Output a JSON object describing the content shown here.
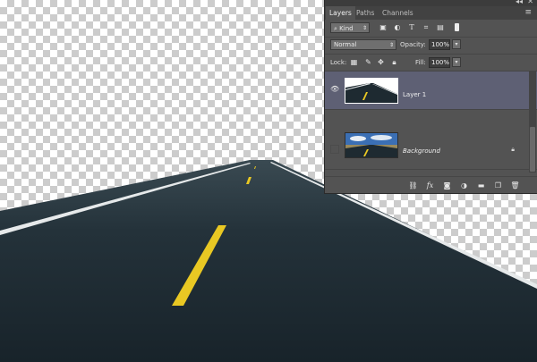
{
  "canvas": {
    "image": "transparent-checkerboard-with-road",
    "colors": {
      "asphalt": "#1f2b32",
      "center_line": "#e9c823",
      "edge_line": "#ffffff"
    }
  },
  "panel": {
    "tabs": [
      {
        "label": "Layers",
        "active": true
      },
      {
        "label": "Paths",
        "active": false
      },
      {
        "label": "Channels",
        "active": false
      }
    ],
    "filter": {
      "kind_label": "Kind",
      "icons": [
        "image-filter-icon",
        "adjustment-filter-icon",
        "type-filter-icon",
        "shape-filter-icon",
        "smart-object-filter-icon",
        "filter-toggle-icon"
      ]
    },
    "blend_mode": "Normal",
    "opacity_label": "Opacity:",
    "opacity_value": "100%",
    "lock_label": "Lock:",
    "fill_label": "Fill:",
    "fill_value": "100%",
    "lock_icons": [
      "lock-transparent-pixels-icon",
      "lock-image-pixels-icon",
      "lock-position-icon",
      "lock-all-icon"
    ],
    "layers": [
      {
        "name": "Layer 1",
        "selected": true,
        "visible": true
      },
      {
        "name": "Background",
        "selected": false,
        "visible": false,
        "locked": true
      }
    ],
    "footer_icons": [
      "link-layers-icon",
      "fx-icon",
      "layer-mask-icon",
      "adjustment-layer-icon",
      "new-group-icon",
      "new-layer-icon",
      "trash-icon"
    ],
    "colors": {
      "panel_bg": "#535353",
      "selected_row": "#5e6074",
      "tab_bar": "#424242"
    }
  }
}
